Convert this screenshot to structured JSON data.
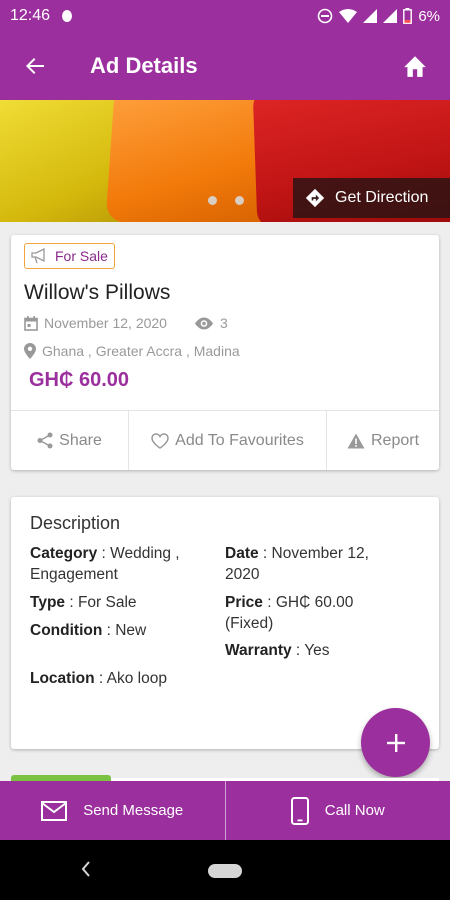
{
  "status_bar": {
    "time": "12:46",
    "battery": "6%"
  },
  "app_bar": {
    "title": "Ad Details"
  },
  "hero": {
    "direction_label": "Get Direction",
    "slide_count": 2
  },
  "ad": {
    "badge": "For Sale",
    "title": "Willow's Pillows",
    "date": "November 12, 2020",
    "views": "3",
    "location": "Ghana , Greater Accra , Madina",
    "price": "GH₵ 60.00"
  },
  "actions": {
    "share": "Share",
    "favourites": "Add To Favourites",
    "report": "Report"
  },
  "description": {
    "title": "Description",
    "category_label": "Category",
    "category_value": " : Wedding ,",
    "category_value2": "Engagement",
    "date_label": "Date",
    "date_value": " : November 12,",
    "date_value2": "2020",
    "type_label": "Type",
    "type_value": " : For Sale",
    "price_label": "Price",
    "price_value": " : GH₵ 60.00",
    "price_value2": "(Fixed)",
    "condition_label": "Condition",
    "condition_value": " : New",
    "warranty_label": "Warranty",
    "warranty_value": " : Yes",
    "location_label": "Location",
    "location_value": " : Ako loop"
  },
  "bottom_bar": {
    "send_message": "Send Message",
    "call_now": "Call Now"
  },
  "colors": {
    "primary": "#9c2f9e",
    "badge_border": "#f2a33a",
    "accent_green": "#7cc242"
  }
}
